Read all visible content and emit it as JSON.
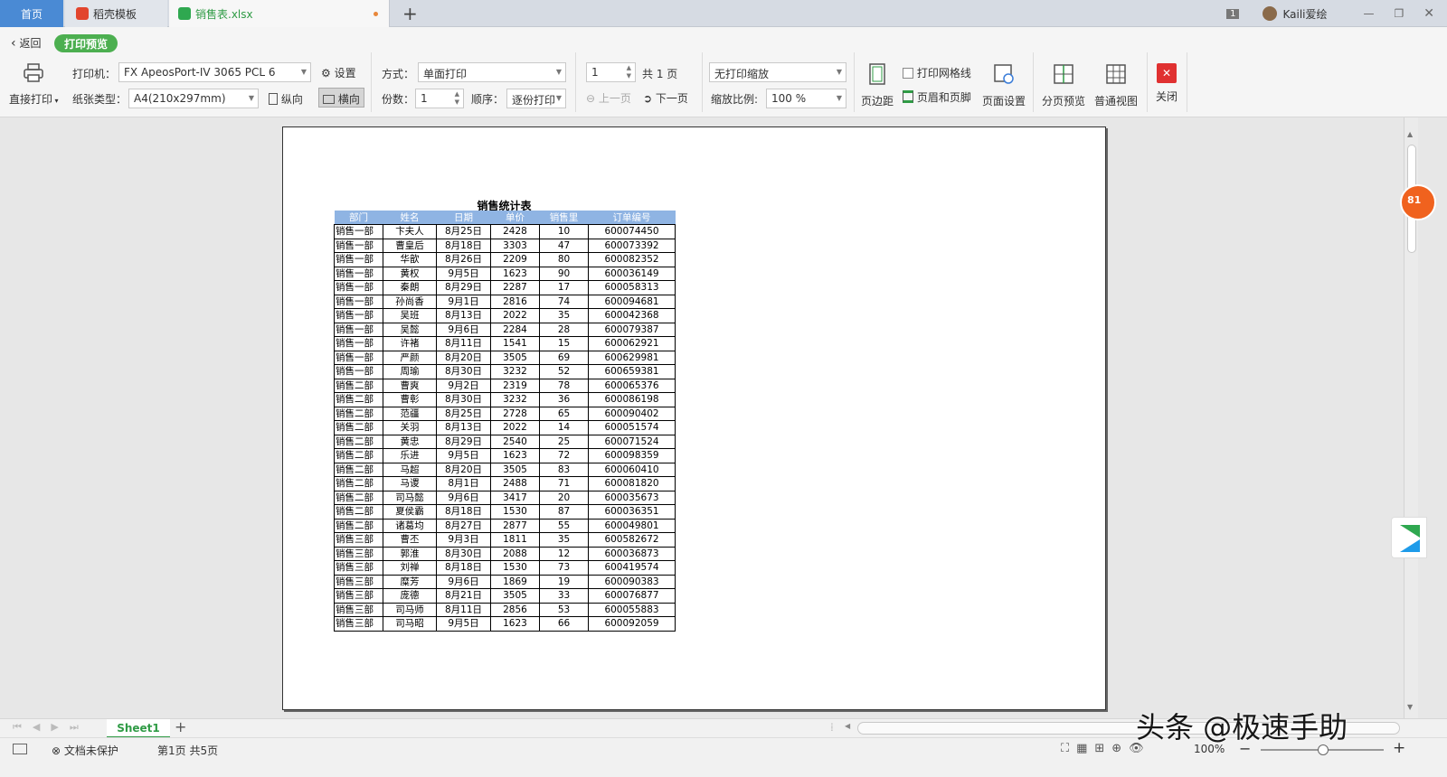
{
  "tabs": [
    {
      "label": "首页"
    },
    {
      "label": "稻壳模板"
    },
    {
      "label": "销售表.xlsx"
    }
  ],
  "window": {
    "badge": "1",
    "user": "Kaili爱绘"
  },
  "toolbar": {
    "back": "返回",
    "print_preview": "打印预览",
    "direct_print": "直接打印",
    "printer_label": "打印机：",
    "printer_value": "FX ApeosPort-IV 3065 PCL 6",
    "settings": "设置",
    "paper_label": "纸张类型：",
    "paper_value": "A4(210x297mm)",
    "portrait": "纵向",
    "landscape": "横向",
    "mode_label": "方式：",
    "mode_value": "单面打印",
    "copies_label": "份数：",
    "copies_value": "1",
    "order_label": "顺序：",
    "order_value": "逐份打印",
    "page_value": "1",
    "total_pages": "共 1 页",
    "prev_page": "上一页",
    "next_page": "下一页",
    "scale_mode": "无打印缩放",
    "scale_label": "缩放比例:",
    "scale_value": "100 %",
    "margins": "页边距",
    "gridlines": "打印网格线",
    "header_footer": "页眉和页脚",
    "page_setup": "页面设置",
    "page_break_preview": "分页预览",
    "normal_view": "普通视图",
    "close": "关闭"
  },
  "sheet": {
    "title": "销售统计表",
    "headers": [
      "部门",
      "姓名",
      "日期",
      "单价",
      "销售里",
      "订单编号"
    ],
    "rows": [
      [
        "销售一部",
        "卞夫人",
        "8月25日",
        "2428",
        "10",
        "600074450"
      ],
      [
        "销售一部",
        "曹皇后",
        "8月18日",
        "3303",
        "47",
        "600073392"
      ],
      [
        "销售一部",
        "华歆",
        "8月26日",
        "2209",
        "80",
        "600082352"
      ],
      [
        "销售一部",
        "黄权",
        "9月5日",
        "1623",
        "90",
        "600036149"
      ],
      [
        "销售一部",
        "秦朗",
        "8月29日",
        "2287",
        "17",
        "600058313"
      ],
      [
        "销售一部",
        "孙尚香",
        "9月1日",
        "2816",
        "74",
        "600094681"
      ],
      [
        "销售一部",
        "吴班",
        "8月13日",
        "2022",
        "35",
        "600042368"
      ],
      [
        "销售一部",
        "吴懿",
        "9月6日",
        "2284",
        "28",
        "600079387"
      ],
      [
        "销售一部",
        "许褚",
        "8月11日",
        "1541",
        "15",
        "600062921"
      ],
      [
        "销售一部",
        "严颜",
        "8月20日",
        "3505",
        "69",
        "600629981"
      ],
      [
        "销售一部",
        "周瑜",
        "8月30日",
        "3232",
        "52",
        "600659381"
      ],
      [
        "销售二部",
        "曹爽",
        "9月2日",
        "2319",
        "78",
        "600065376"
      ],
      [
        "销售二部",
        "曹彰",
        "8月30日",
        "3232",
        "36",
        "600086198"
      ],
      [
        "销售二部",
        "范疆",
        "8月25日",
        "2728",
        "65",
        "600090402"
      ],
      [
        "销售二部",
        "关羽",
        "8月13日",
        "2022",
        "14",
        "600051574"
      ],
      [
        "销售二部",
        "黄忠",
        "8月29日",
        "2540",
        "25",
        "600071524"
      ],
      [
        "销售二部",
        "乐进",
        "9月5日",
        "1623",
        "72",
        "600098359"
      ],
      [
        "销售二部",
        "马超",
        "8月20日",
        "3505",
        "83",
        "600060410"
      ],
      [
        "销售二部",
        "马谡",
        "8月1日",
        "2488",
        "71",
        "600081820"
      ],
      [
        "销售二部",
        "司马懿",
        "9月6日",
        "3417",
        "20",
        "600035673"
      ],
      [
        "销售二部",
        "夏侯霸",
        "8月18日",
        "1530",
        "87",
        "600036351"
      ],
      [
        "销售二部",
        "诸葛均",
        "8月27日",
        "2877",
        "55",
        "600049801"
      ],
      [
        "销售三部",
        "曹丕",
        "9月3日",
        "1811",
        "35",
        "600582672"
      ],
      [
        "销售三部",
        "郭淮",
        "8月30日",
        "2088",
        "12",
        "600036873"
      ],
      [
        "销售三部",
        "刘禅",
        "8月18日",
        "1530",
        "73",
        "600419574"
      ],
      [
        "销售三部",
        "糜芳",
        "9月6日",
        "1869",
        "19",
        "600090383"
      ],
      [
        "销售三部",
        "庞德",
        "8月21日",
        "3505",
        "33",
        "600076877"
      ],
      [
        "销售三部",
        "司马师",
        "8月11日",
        "2856",
        "53",
        "600055883"
      ],
      [
        "销售三部",
        "司马昭",
        "9月5日",
        "1623",
        "66",
        "600092059"
      ]
    ]
  },
  "side": {
    "badge": "81"
  },
  "sheet_tabs": {
    "active": "Sheet1"
  },
  "status": {
    "protect": "文档未保护",
    "page_info": "第1页 共5页",
    "zoom": "100%"
  },
  "watermark": "头条 @极速手助"
}
